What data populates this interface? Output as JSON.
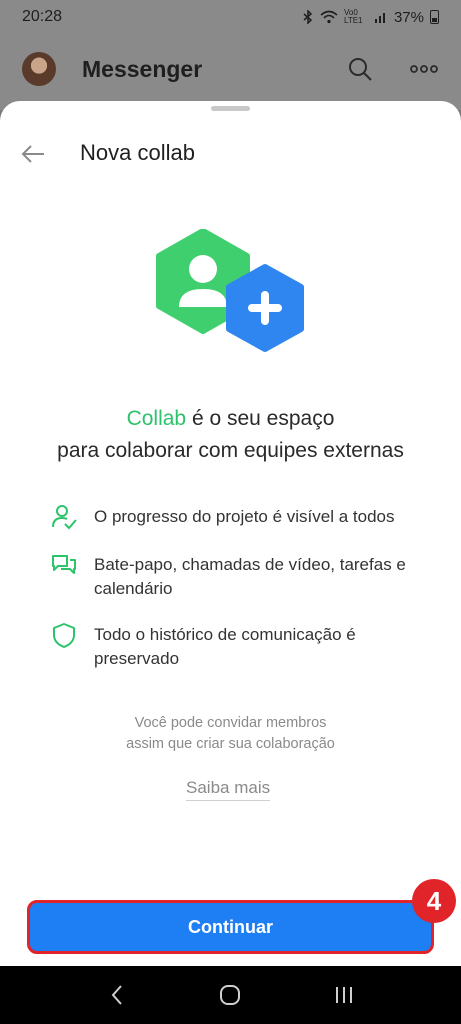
{
  "status_bar": {
    "time": "20:28",
    "battery": "37%",
    "network": "Vo0 LTE1"
  },
  "background_app": {
    "title": "Messenger",
    "icons": [
      "search-icon",
      "more-icon"
    ]
  },
  "sheet": {
    "title": "Nova collab",
    "headline_accent": "Collab",
    "headline_rest": " é o seu espaço",
    "headline_line2": "para colaborar com equipes externas",
    "features": [
      {
        "icon": "user-check-icon",
        "text": "O progresso do projeto é visível a todos"
      },
      {
        "icon": "chat-bubbles-icon",
        "text": "Bate-papo, chamadas de vídeo, tarefas e calendário"
      },
      {
        "icon": "shield-icon",
        "text": "Todo o histórico de comunicação é preservado"
      }
    ],
    "invite_note_line1": "Você pode convidar membros",
    "invite_note_line2": "assim que criar sua colaboração",
    "learn_more": "Saiba mais",
    "continue_label": "Continuar"
  },
  "annotation": {
    "badge_number": "4"
  },
  "colors": {
    "accent_green": "#2cc36b",
    "primary_blue": "#1e7ef4",
    "annotation_red": "#e0242a"
  }
}
